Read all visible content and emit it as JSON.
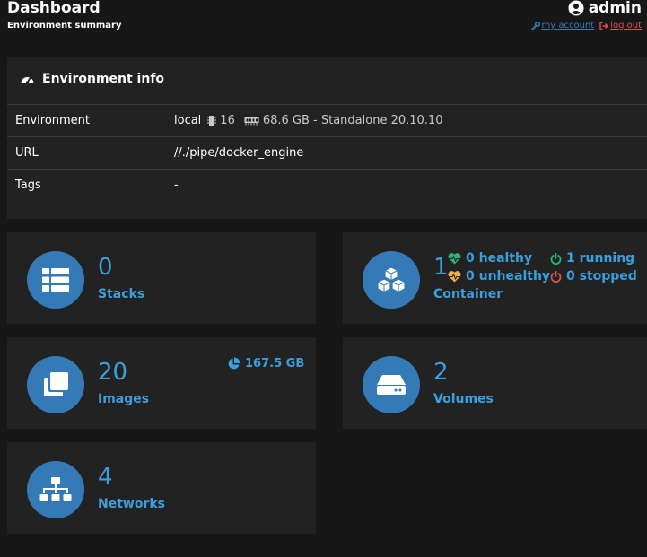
{
  "header": {
    "title": "Dashboard",
    "subtitle": "Environment summary",
    "username": "admin",
    "my_account": "my account",
    "log_out": "log out"
  },
  "environment": {
    "heading": "Environment info",
    "rows": [
      {
        "label": "Environment",
        "value_name": "local",
        "cpu": "16",
        "memory": "68.6 GB - Standalone 20.10.10"
      },
      {
        "label": "URL",
        "value": "//./pipe/docker_engine"
      },
      {
        "label": "Tags",
        "value": "-"
      }
    ]
  },
  "tiles": {
    "stacks": {
      "count": "0",
      "label": "Stacks"
    },
    "containers": {
      "count": "1",
      "label": "Container",
      "healthy": "0 healthy",
      "unhealthy": "0 unhealthy",
      "running": "1 running",
      "stopped": "0 stopped"
    },
    "images": {
      "count": "20",
      "label": "Images",
      "size": "167.5 GB"
    },
    "volumes": {
      "count": "2",
      "label": "Volumes"
    },
    "networks": {
      "count": "4",
      "label": "Networks"
    }
  },
  "colors": {
    "accent": "#3a9fdf",
    "icon_bg": "#337ab7",
    "healthy": "#2ab27b",
    "unhealthy": "#f0ad4e",
    "stopped": "#d9534f",
    "link": "#337ab7",
    "logout": "#d9534f"
  },
  "icons": {
    "environment": "tachometer-icon",
    "cpu": "microchip-icon",
    "memory": "memory-icon",
    "stacks": "th-list-icon",
    "containers": "cubes-icon",
    "images": "clone-icon",
    "volumes": "hdd-icon",
    "networks": "sitemap-icon"
  }
}
